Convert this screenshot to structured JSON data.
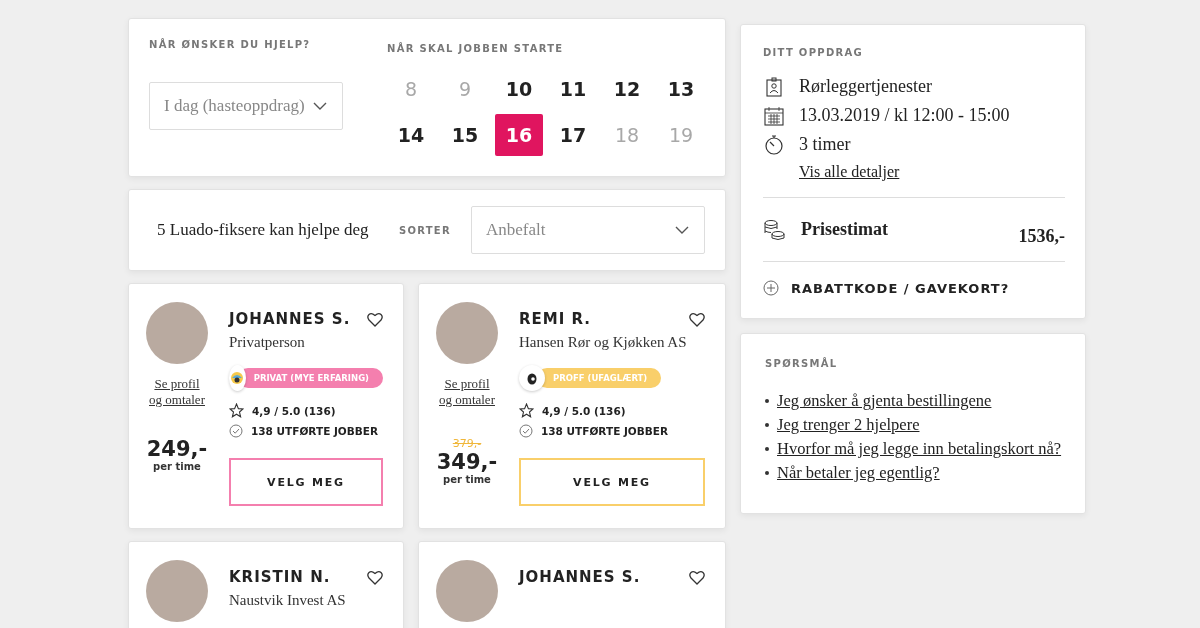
{
  "booking": {
    "when_label": "NÅR ØNSKER DU HJELP?",
    "when_select": {
      "value": "I dag (hasteoppdrag)"
    },
    "start_label": "NÅR SKAL JOBBEN STARTE",
    "days": [
      {
        "label": "8",
        "disabled": true,
        "selected": false
      },
      {
        "label": "9",
        "disabled": true,
        "selected": false
      },
      {
        "label": "10",
        "disabled": false,
        "selected": false
      },
      {
        "label": "11",
        "disabled": false,
        "selected": false
      },
      {
        "label": "12",
        "disabled": false,
        "selected": false
      },
      {
        "label": "13",
        "disabled": false,
        "selected": false
      },
      {
        "label": "14",
        "disabled": false,
        "selected": false
      },
      {
        "label": "15",
        "disabled": false,
        "selected": false
      },
      {
        "label": "16",
        "disabled": false,
        "selected": true
      },
      {
        "label": "17",
        "disabled": false,
        "selected": false
      },
      {
        "label": "18",
        "disabled": true,
        "selected": false
      },
      {
        "label": "19",
        "disabled": true,
        "selected": false
      }
    ]
  },
  "results": {
    "count_text": "5 Luado-fiksere kan hjelpe deg",
    "sort_label": "SORTER",
    "sort_select": {
      "value": "Anbefalt"
    }
  },
  "helpers": [
    {
      "name": "JOHANNES S.",
      "subtitle": "Privatperson",
      "profile_link": "Se profil og omtaler",
      "badge": {
        "label": "PRIVAT (MYE ERFARING)",
        "color": "#f47fae",
        "kind": "private"
      },
      "rating": "4,9 / 5.0 (136)",
      "jobs": "138 UTFØRTE JOBBER",
      "price": "249,-",
      "price_unit": "per time",
      "button": "VELG MEG"
    },
    {
      "name": "REMI R.",
      "subtitle": "Hansen Rør og Kjøkken AS",
      "profile_link": "Se profil og omtaler",
      "badge": {
        "label": "PROFF (UFAGLÆRT)",
        "color": "#f9cf6a",
        "kind": "pro"
      },
      "rating": "4,9 / 5.0 (136)",
      "jobs": "138 UTFØRTE JOBBER",
      "old_price": "379,-",
      "price": "349,-",
      "price_unit": "per time",
      "button": "VELG MEG"
    },
    {
      "name": "KRISTIN N.",
      "subtitle": "Naustvik Invest AS"
    },
    {
      "name": "JOHANNES S."
    }
  ],
  "assignment": {
    "title": "DITT OPPDRAG",
    "details": [
      {
        "kind": "service",
        "text": "Rørleggertjenester"
      },
      {
        "kind": "date",
        "text": "13.03.2019 / kl 12:00 - 15:00"
      },
      {
        "kind": "duration",
        "text": "3 timer"
      }
    ],
    "details_link": "Vis alle detaljer",
    "estimate_label": "Prisestimat",
    "estimate_value": "1536,-",
    "discount": "RABATTKODE / GAVEKORT?"
  },
  "questions": {
    "title": "SPØRSMÅL",
    "items": [
      "Jeg ønsker å gjenta bestillingene",
      "Jeg trenger 2 hjelpere",
      "Hvorfor må jeg legge inn betalingskort nå?",
      "Når betaler jeg egentlig?"
    ]
  }
}
